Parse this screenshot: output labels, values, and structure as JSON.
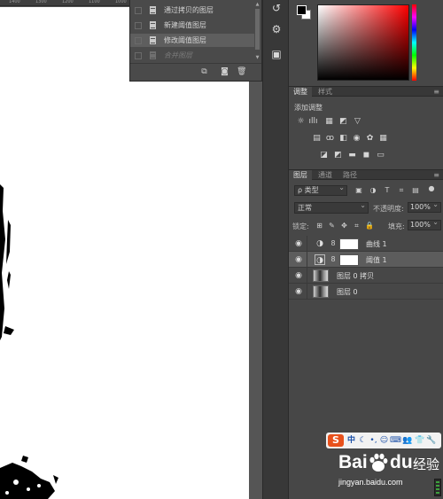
{
  "ruler": {
    "ticks": [
      "1400",
      "1300",
      "1200",
      "1100",
      "1000"
    ]
  },
  "history": {
    "items": [
      {
        "label": "通过拷贝的图层",
        "state": "normal"
      },
      {
        "label": "新建阈值图层",
        "state": "normal"
      },
      {
        "label": "修改阈值图层",
        "state": "active"
      },
      {
        "label": "合并图层",
        "state": "future"
      }
    ],
    "footer_icons": [
      "new-document-from-state-icon",
      "camera-icon",
      "trash-icon"
    ]
  },
  "color": {
    "foreground": "#000000",
    "background": "#ffffff",
    "hue": "#ff0000"
  },
  "adjustments": {
    "tabs": [
      "调整",
      "样式"
    ],
    "active_tab": "调整",
    "title": "添加调整"
  },
  "layers": {
    "tabs": [
      "图层",
      "通道",
      "路径"
    ],
    "active_tab": "图层",
    "kind_filter": "ρ 类型",
    "blend_mode": "正常",
    "opacity_label": "不透明度:",
    "opacity_value": "100%",
    "lock_label": "锁定:",
    "fill_label": "填充:",
    "fill_value": "100%",
    "items": [
      {
        "name": "曲线 1",
        "type": "adjustment",
        "selected": false
      },
      {
        "name": "阈值 1",
        "type": "adjustment",
        "selected": true
      },
      {
        "name": "图层 0 拷贝",
        "type": "image",
        "selected": false
      },
      {
        "name": "图层 0",
        "type": "image",
        "selected": false
      }
    ]
  },
  "watermark": {
    "logo_bai": "Bai",
    "logo_du": "du",
    "logo_jingyan": "经验",
    "url": "jingyan.baidu.com",
    "ime_label": "S",
    "ime_text": "中"
  }
}
